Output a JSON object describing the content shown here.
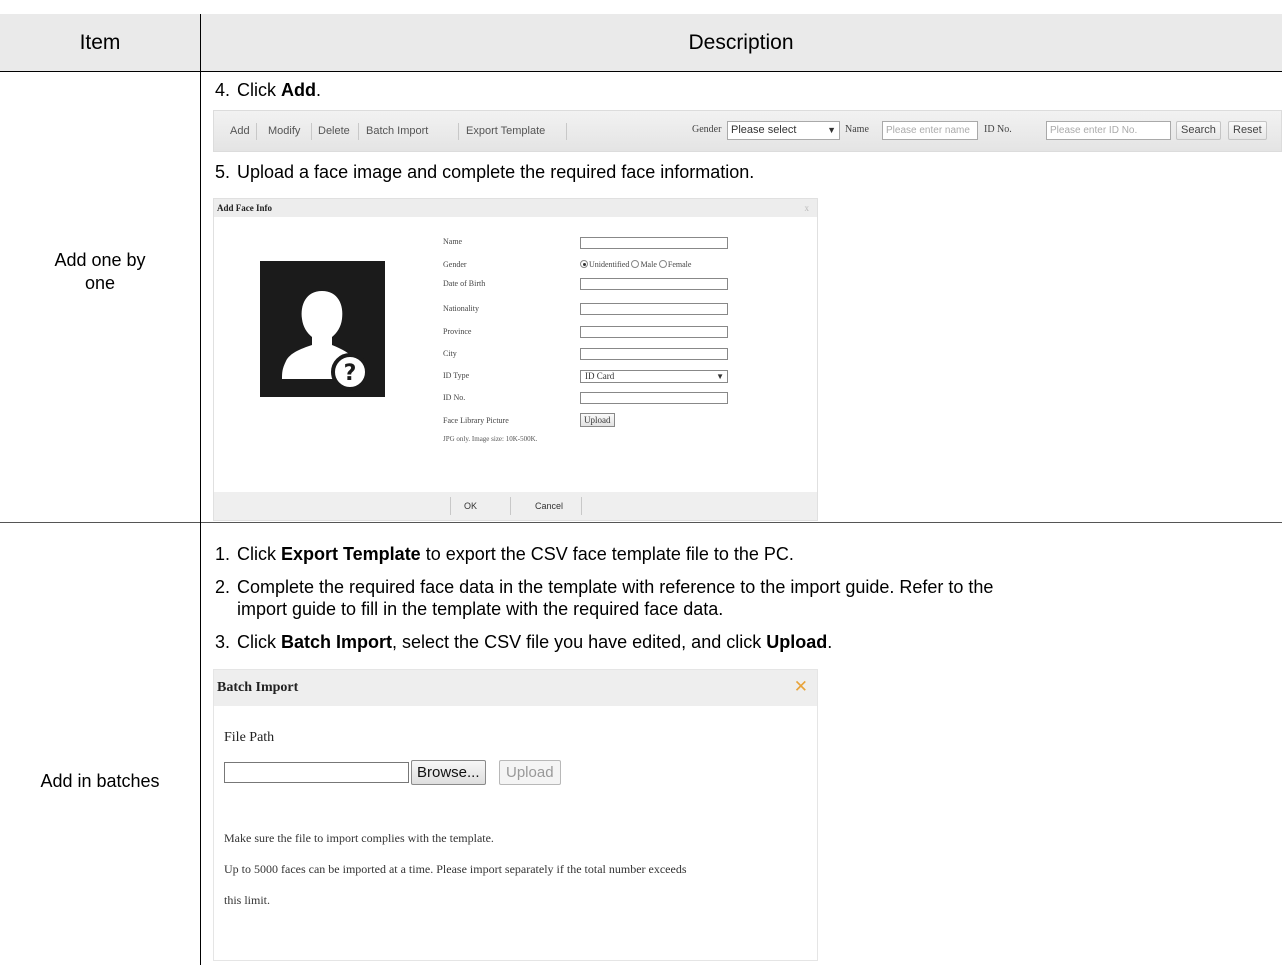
{
  "header": {
    "item": "Item",
    "description": "Description"
  },
  "rows": [
    {
      "label_line1": "Add one by",
      "label_line2": "one"
    },
    {
      "label": "Add in batches"
    }
  ],
  "one_by_one": {
    "step4": {
      "num": "4.",
      "pre": "Click ",
      "bold": "Add",
      "post": "."
    },
    "step5": {
      "num": "5.",
      "text": "Upload a face image and complete the required face information."
    }
  },
  "toolbar": {
    "add": "Add",
    "modify": "Modify",
    "delete": "Delete",
    "batch_import": "Batch Import",
    "export_template": "Export Template",
    "gender_label": "Gender",
    "gender_value": "Please select",
    "name_label": "Name",
    "name_placeholder": "Please enter name",
    "id_label": "ID No.",
    "id_placeholder": "Please enter ID No.",
    "search": "Search",
    "reset": "Reset"
  },
  "face_dialog": {
    "title": "Add Face Info",
    "close": "x",
    "fields": {
      "name": "Name",
      "gender": "Gender",
      "dob": "Date of Birth",
      "nationality": "Nationality",
      "province": "Province",
      "city": "City",
      "id_type": "ID Type",
      "id_no": "ID No.",
      "picture": "Face Library Picture"
    },
    "gender_options": [
      "Unidentified",
      "Male",
      "Female"
    ],
    "id_type_value": "ID Card",
    "upload": "Upload",
    "hint": "JPG only. Image size: 10K-500K.",
    "ok": "OK",
    "cancel": "Cancel"
  },
  "batches": {
    "step1": {
      "num": "1.",
      "pre": "Click ",
      "bold": "Export Template",
      "post": " to export the CSV face template file to the PC."
    },
    "step2": {
      "num": "2.",
      "line1": "Complete the required face data in the template with reference to the import guide. Refer to the",
      "line2": "import guide to fill in the template with the required face data."
    },
    "step3": {
      "num": "3.",
      "pre": "Click ",
      "bold1": "Batch Import",
      "mid": ", select the CSV file you have edited, and click ",
      "bold2": "Upload",
      "post": "."
    }
  },
  "batch_dialog": {
    "title": "Batch Import",
    "close": "✕",
    "file_path_label": "File Path",
    "browse": "Browse...",
    "upload": "Upload",
    "note1": "Make sure the file to import complies with the template.",
    "note2": "Up to 5000 faces can be imported at a time. Please import separately if the total number exceeds",
    "note3": "this limit."
  },
  "colors": {
    "header_bg": "#eaeaea",
    "close_accent": "#e8a33a"
  }
}
